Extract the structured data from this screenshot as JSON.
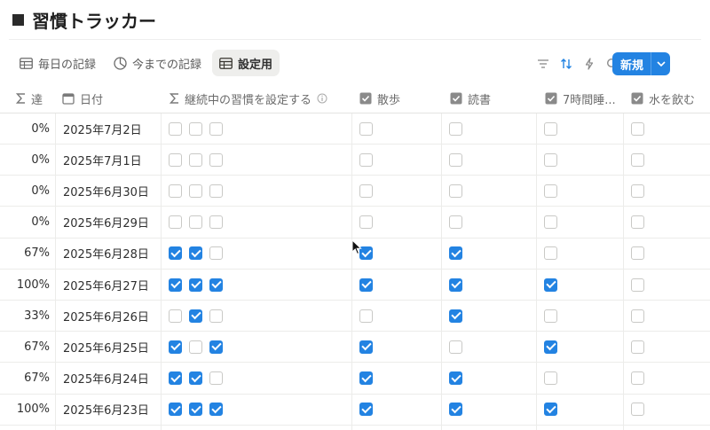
{
  "page": {
    "title": "習慣トラッカー"
  },
  "views": [
    {
      "label": "毎日の記録",
      "icon": "table-icon",
      "active": false
    },
    {
      "label": "今までの記録",
      "icon": "pie-chart-icon",
      "active": false
    },
    {
      "label": "設定用",
      "icon": "table-icon",
      "active": true
    }
  ],
  "toolbar": {
    "icons": [
      "filter-icon",
      "sort-icon",
      "lightning-icon",
      "search-icon",
      "expand-icon",
      "settings-icon"
    ],
    "new_label": "新規",
    "accent": "#2383e2"
  },
  "columns": {
    "achievement": "達",
    "date": "日付",
    "streak": "継続中の習慣を設定する",
    "walk": "散歩",
    "read": "読書",
    "sleep": "7時間睡...",
    "water": "水を飲む"
  },
  "rows": [
    {
      "pct": "0%",
      "date": "2025年7月2日",
      "streak": [
        false,
        false,
        false
      ],
      "walk": false,
      "read": false,
      "sleep": false,
      "water": false
    },
    {
      "pct": "0%",
      "date": "2025年7月1日",
      "streak": [
        false,
        false,
        false
      ],
      "walk": false,
      "read": false,
      "sleep": false,
      "water": false
    },
    {
      "pct": "0%",
      "date": "2025年6月30日",
      "streak": [
        false,
        false,
        false
      ],
      "walk": false,
      "read": false,
      "sleep": false,
      "water": false
    },
    {
      "pct": "0%",
      "date": "2025年6月29日",
      "streak": [
        false,
        false,
        false
      ],
      "walk": false,
      "read": false,
      "sleep": false,
      "water": false
    },
    {
      "pct": "67%",
      "date": "2025年6月28日",
      "streak": [
        true,
        true,
        false
      ],
      "walk": true,
      "read": true,
      "sleep": false,
      "water": false
    },
    {
      "pct": "100%",
      "date": "2025年6月27日",
      "streak": [
        true,
        true,
        true
      ],
      "walk": true,
      "read": true,
      "sleep": true,
      "water": false
    },
    {
      "pct": "33%",
      "date": "2025年6月26日",
      "streak": [
        false,
        true,
        false
      ],
      "walk": false,
      "read": true,
      "sleep": false,
      "water": false
    },
    {
      "pct": "67%",
      "date": "2025年6月25日",
      "streak": [
        true,
        false,
        true
      ],
      "walk": true,
      "read": false,
      "sleep": true,
      "water": false
    },
    {
      "pct": "67%",
      "date": "2025年6月24日",
      "streak": [
        true,
        true,
        false
      ],
      "walk": true,
      "read": true,
      "sleep": false,
      "water": false
    },
    {
      "pct": "100%",
      "date": "2025年6月23日",
      "streak": [
        true,
        true,
        true
      ],
      "walk": true,
      "read": true,
      "sleep": true,
      "water": false
    }
  ]
}
